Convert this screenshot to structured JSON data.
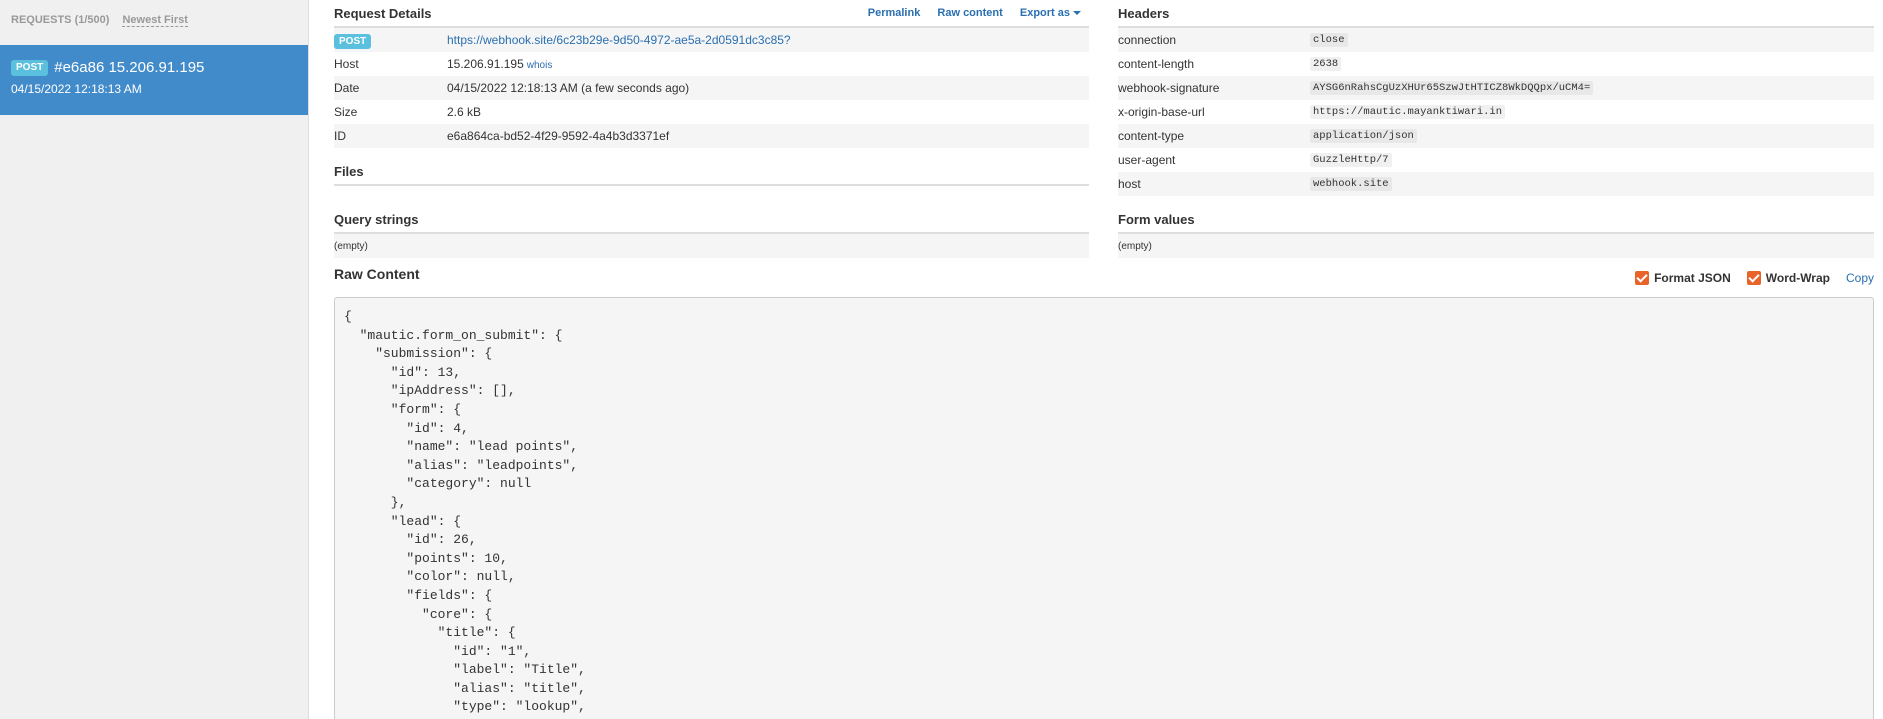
{
  "sidebar": {
    "requests_count": "REQUESTS (1/500)",
    "sort_label": "Newest First",
    "items": [
      {
        "method": "POST",
        "title": "#e6a86 15.206.91.195",
        "date": "04/15/2022 12:18:13 AM"
      }
    ]
  },
  "request_details": {
    "title": "Request Details",
    "actions": {
      "permalink": "Permalink",
      "raw_content": "Raw content",
      "export_as": "Export as"
    },
    "method": "POST",
    "url": "https://webhook.site/6c23b29e-9d50-4972-ae5a-2d0591dc3c85?",
    "host_label": "Host",
    "host_value": "15.206.91.195",
    "whois": "whois",
    "date_label": "Date",
    "date_value": "04/15/2022 12:18:13 AM (a few seconds ago)",
    "size_label": "Size",
    "size_value": "2.6 kB",
    "id_label": "ID",
    "id_value": "e6a864ca-bd52-4f29-9592-4a4b3d3371ef"
  },
  "files": {
    "title": "Files"
  },
  "query_strings": {
    "title": "Query strings",
    "empty": "(empty)"
  },
  "headers": {
    "title": "Headers",
    "rows": [
      {
        "key": "connection",
        "value": "close"
      },
      {
        "key": "content-length",
        "value": "2638"
      },
      {
        "key": "webhook-signature",
        "value": "AYSG6nRahsCgUzXHUr65SzwJtHTICZ8WkDQQpx/uCM4="
      },
      {
        "key": "x-origin-base-url",
        "value": "https://mautic.mayanktiwari.in"
      },
      {
        "key": "content-type",
        "value": "application/json"
      },
      {
        "key": "user-agent",
        "value": "GuzzleHttp/7"
      },
      {
        "key": "host",
        "value": "webhook.site"
      }
    ]
  },
  "form_values": {
    "title": "Form values",
    "empty": "(empty)"
  },
  "raw_content": {
    "title": "Raw Content",
    "format_json": "Format JSON",
    "word_wrap": "Word-Wrap",
    "copy": "Copy",
    "body": "{\n  \"mautic.form_on_submit\": {\n    \"submission\": {\n      \"id\": 13,\n      \"ipAddress\": [],\n      \"form\": {\n        \"id\": 4,\n        \"name\": \"lead points\",\n        \"alias\": \"leadpoints\",\n        \"category\": null\n      },\n      \"lead\": {\n        \"id\": 26,\n        \"points\": 10,\n        \"color\": null,\n        \"fields\": {\n          \"core\": {\n            \"title\": {\n              \"id\": \"1\",\n              \"label\": \"Title\",\n              \"alias\": \"title\",\n              \"type\": \"lookup\","
  }
}
